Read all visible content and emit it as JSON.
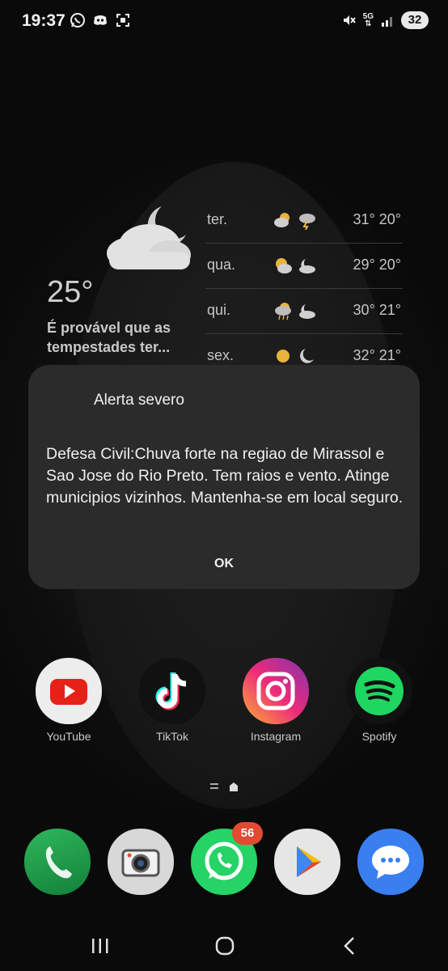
{
  "status_bar": {
    "time": "19:37",
    "left_icons": [
      "whatsapp-icon",
      "discord-icon",
      "screenshot-icon"
    ],
    "right_icons": [
      "mute-icon",
      "5g-icon",
      "signal-icon"
    ],
    "network": "5G",
    "battery": "32"
  },
  "weather": {
    "current_temp": "25°",
    "description": "É provável que as tempestades ter...",
    "forecast": [
      {
        "day": "ter.",
        "temps": "31° 20°",
        "day_icon": "partly-cloudy-icon",
        "night_icon": "thunderstorm-icon"
      },
      {
        "day": "qua.",
        "temps": "29° 20°",
        "day_icon": "partly-cloudy-icon",
        "night_icon": "cloudy-night-icon"
      },
      {
        "day": "qui.",
        "temps": "30° 21°",
        "day_icon": "storm-icon",
        "night_icon": "cloudy-night-icon"
      },
      {
        "day": "sex.",
        "temps": "32° 21°",
        "day_icon": "sun-icon",
        "night_icon": "moon-icon"
      }
    ]
  },
  "dialog": {
    "title": "Alerta severo",
    "body": "Defesa Civil:Chuva forte na regiao de Mirassol e Sao Jose do Rio Preto. Tem raios e vento. Atinge municipios vizinhos. Mantenha-se em local seguro.",
    "ok_label": "OK"
  },
  "apps": [
    {
      "label": "YouTube"
    },
    {
      "label": "TikTok"
    },
    {
      "label": "Instagram"
    },
    {
      "label": "Spotify"
    }
  ],
  "dock": {
    "apps": [
      "phone-icon",
      "camera-icon",
      "whatsapp-icon",
      "play-store-icon",
      "messages-icon"
    ],
    "whatsapp_badge": "56"
  },
  "nav": [
    "recents-button",
    "home-button",
    "back-button"
  ],
  "colors": {
    "youtube": "#e62117",
    "whatsapp": "#25d366",
    "spotify": "#1ed760",
    "phone": "#1f9c4a",
    "messages": "#3a7ff0",
    "badge": "#e04b32"
  }
}
